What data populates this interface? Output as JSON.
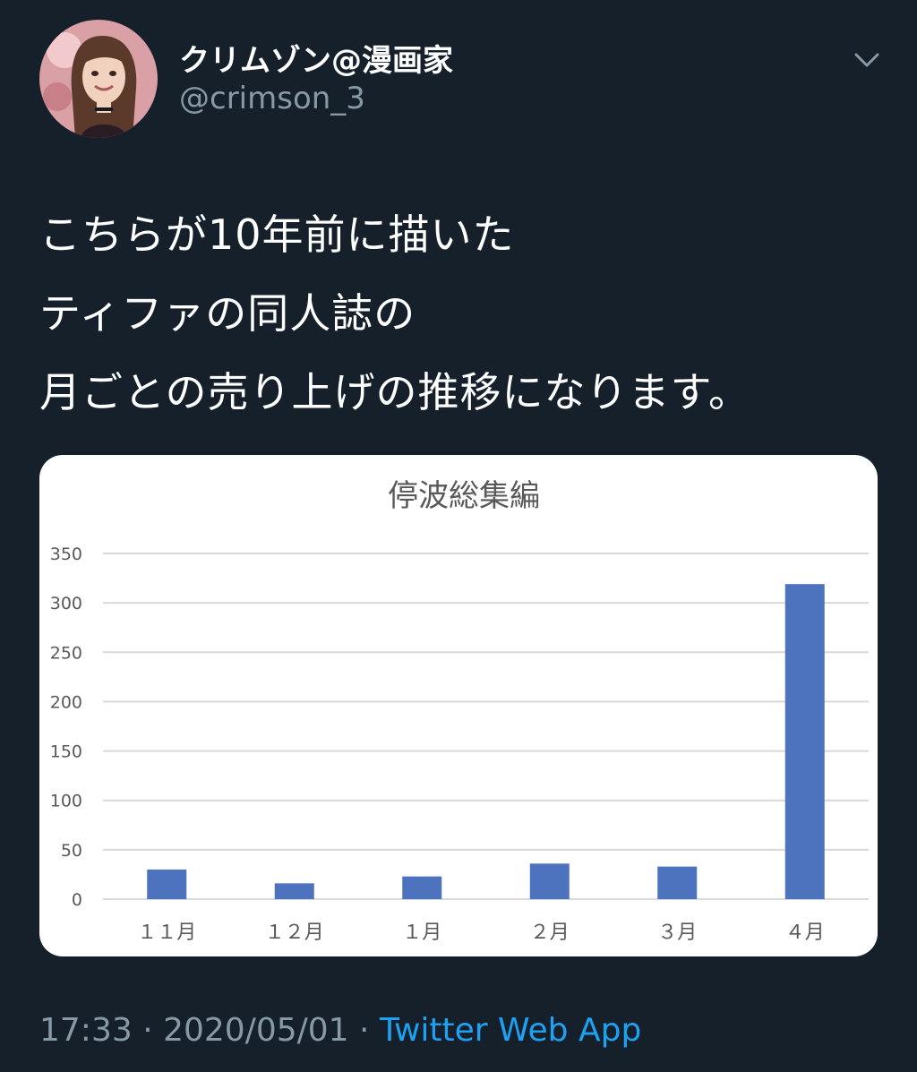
{
  "author": {
    "display_name": "クリムゾン@漫画家",
    "handle": "@crimson_3"
  },
  "tweet": {
    "lines": [
      "こちらが10年前に描いた",
      "ティファの同人誌の",
      "月ごとの売り上げの推移になります。"
    ],
    "time": "17:33",
    "separator": " · ",
    "date": "2020/05/01",
    "source": "Twitter Web App"
  },
  "icons": {
    "menu": "chevron-down-icon",
    "avatar": "profile-avatar-image"
  },
  "colors": {
    "background": "#15202b",
    "secondary_text": "#8899a6",
    "link": "#1da1f2",
    "bar": "#4e73be",
    "gridline": "#d9d9d9"
  },
  "chart_data": {
    "type": "bar",
    "title": "停波総集編",
    "categories": [
      "１１月",
      "１２月",
      "１月",
      "２月",
      "３月",
      "４月"
    ],
    "values": [
      30,
      16,
      23,
      36,
      33,
      319
    ],
    "ylim": [
      0,
      350
    ],
    "yticks": [
      0,
      50,
      100,
      150,
      200,
      250,
      300,
      350
    ],
    "grid": true,
    "legend": "none",
    "xlabel": "",
    "ylabel": ""
  }
}
